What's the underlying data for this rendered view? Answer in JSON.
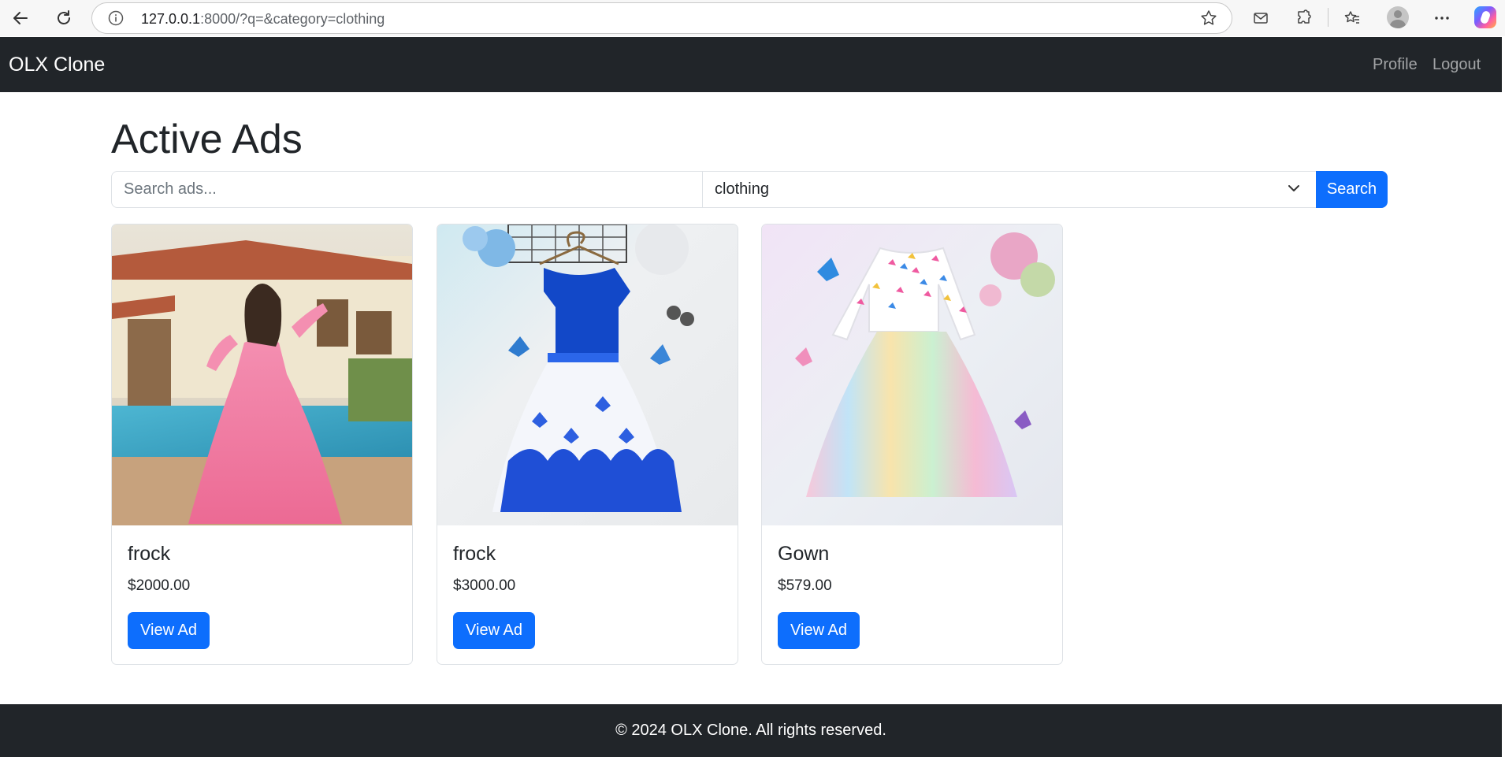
{
  "browser": {
    "url_host": "127.0.0.1",
    "url_rest": ":8000/?q=&category=clothing"
  },
  "site": {
    "brand": "OLX Clone",
    "nav_links": [
      "Profile",
      "Logout"
    ]
  },
  "main": {
    "title": "Active Ads",
    "search": {
      "placeholder": "Search ads...",
      "value": "",
      "category_selected": "clothing",
      "button_label": "Search"
    },
    "ads": [
      {
        "title": "frock",
        "price": "$2000.00",
        "button": "View Ad",
        "image": "pink-gown-photo"
      },
      {
        "title": "frock",
        "price": "$3000.00",
        "button": "View Ad",
        "image": "blue-butterfly-dress-photo"
      },
      {
        "title": "Gown",
        "price": "$579.00",
        "button": "View Ad",
        "image": "rainbow-tulle-dress-photo"
      }
    ]
  },
  "footer": {
    "text": "© 2024 OLX Clone. All rights reserved."
  },
  "colors": {
    "navbar": "#212529",
    "primary": "#0d6efd",
    "border": "#dee2e6"
  }
}
